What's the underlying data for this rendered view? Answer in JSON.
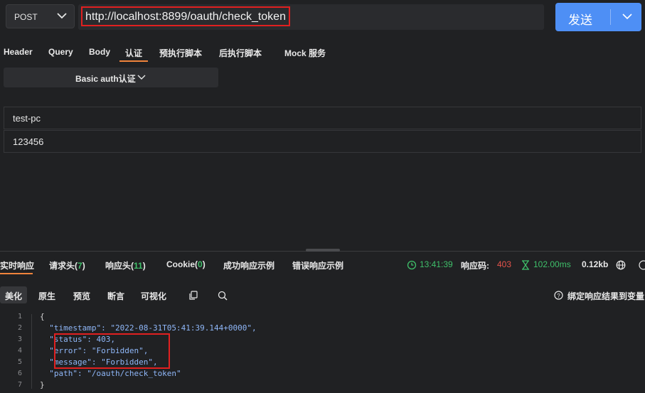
{
  "request": {
    "method": "POST",
    "url": "http://localhost:8899/oauth/check_token",
    "send_label": "发送"
  },
  "request_tabs": [
    "Header",
    "Query",
    "Body",
    "认证",
    "预执行脚本",
    "后执行脚本",
    "Mock 服务"
  ],
  "active_request_tab": "认证",
  "auth": {
    "type_label": "Basic auth认证",
    "username": "test-pc",
    "password": "123456"
  },
  "response": {
    "tabs": {
      "realtime": "实时响应",
      "req_headers": "请求头",
      "req_headers_count": "7",
      "resp_headers": "响应头",
      "resp_headers_count": "11",
      "cookie": "Cookie",
      "cookie_count": "0",
      "success_example": "成功响应示例",
      "error_example": "错误响应示例"
    },
    "stats": {
      "time": "13:41:39",
      "code_label": "响应码:",
      "code": "403",
      "duration": "102.00ms",
      "size": "0.12kb"
    },
    "view_tabs": [
      "美化",
      "原生",
      "预览",
      "断言",
      "可视化"
    ],
    "bind_label": "绑定响应结果到变量",
    "body_lines": [
      "{",
      "  \"timestamp\": \"2022-08-31T05:41:39.144+0000\",",
      "  \"status\": 403,",
      "  \"error\": \"Forbidden\",",
      "  \"message\": \"Forbidden\",",
      "  \"path\": \"/oauth/check_token\"",
      "}"
    ],
    "line_numbers": [
      "1",
      "2",
      "3",
      "4",
      "5",
      "6",
      "7"
    ]
  }
}
